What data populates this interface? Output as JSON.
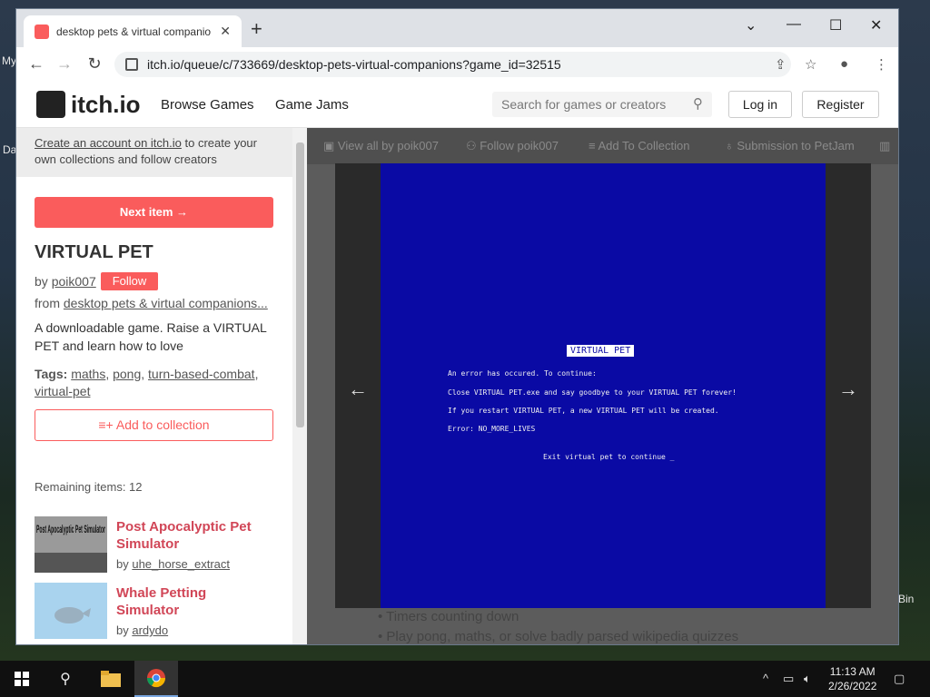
{
  "desktop": {
    "label_my": "My",
    "label_da": "Da",
    "label_bin": "Bin"
  },
  "browser": {
    "tab_title": "desktop pets & virtual companio",
    "url": "itch.io/queue/c/733669/desktop-pets-virtual-companions?game_id=32515"
  },
  "itch": {
    "logo": "itch.io",
    "nav": [
      "Browse Games",
      "Game Jams"
    ],
    "search_placeholder": "Search for games or creators",
    "login": "Log in",
    "register": "Register"
  },
  "sidebar": {
    "promo_link": "Create an account on itch.io",
    "promo_rest": " to create your own collections and follow creators",
    "next_item": "Next item →",
    "game_title": "VIRTUAL PET",
    "by_prefix": "by ",
    "author": "poik007",
    "follow": "Follow",
    "from_prefix": "from ",
    "from_collection": "desktop pets & virtual companions...",
    "description": "A downloadable game. Raise a VIRTUAL PET and learn how to love",
    "tags_label": "Tags:",
    "tags": [
      "maths",
      "pong",
      "turn-based-combat",
      "virtual-pet"
    ],
    "add_to_collection": "Add to collection",
    "remaining": "Remaining items: 12",
    "items": [
      {
        "title": "Post Apocalyptic Pet Simulator",
        "by": "by ",
        "author": "uhe_horse_extract",
        "thumb_text": "Post Apocalyptic Pet Simulator"
      },
      {
        "title": "Whale Petting Simulator",
        "by": "by ",
        "author": "ardydo"
      }
    ]
  },
  "main": {
    "toolbar": [
      "View all by poik007",
      "Follow poik007",
      "Add To Collection",
      "Submission to PetJam"
    ],
    "page_lines": [
      "Timers counting down",
      "Play pong, maths, or solve badly parsed wikipedia quizzes"
    ],
    "screen": {
      "title": "VIRTUAL PET",
      "lines": [
        "An error has occured. To continue:",
        "Close VIRTUAL PET.exe and say goodbye to your VIRTUAL PET forever!",
        "If you restart VIRTUAL PET, a new VIRTUAL PET will be created.",
        "Error: NO_MORE_LIVES"
      ],
      "exit": "Exit virtual pet to continue _"
    }
  },
  "taskbar": {
    "time": "11:13 AM",
    "date": "2/26/2022"
  }
}
